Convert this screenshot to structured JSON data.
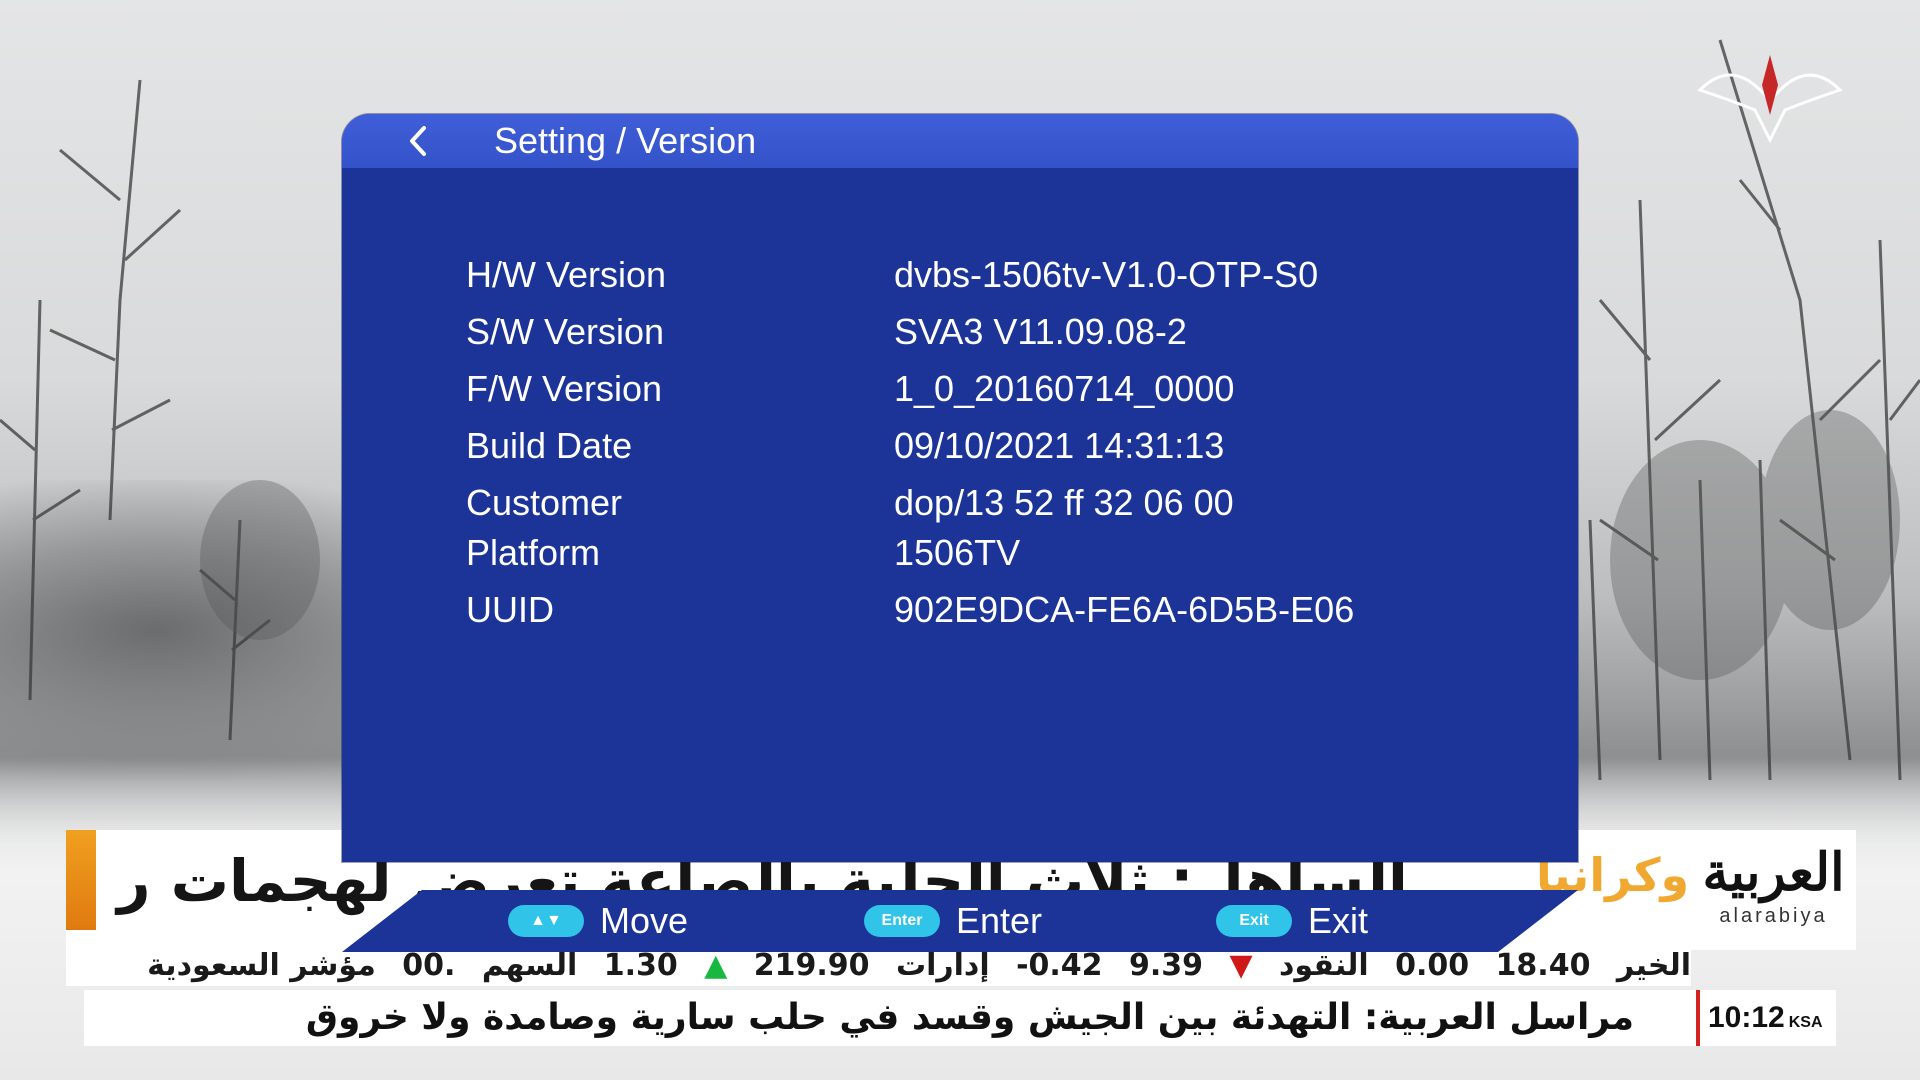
{
  "osd": {
    "title": "Setting / Version",
    "rows": [
      {
        "label": "H/W Version",
        "value": "dvbs-1506tv-V1.0-OTP-S0"
      },
      {
        "label": "S/W Version",
        "value": "SVA3 V11.09.08-2"
      },
      {
        "label": "F/W Version",
        "value": "1_0_20160714_0000"
      },
      {
        "label": "Build Date",
        "value": "09/10/2021 14:31:13"
      },
      {
        "label": "Customer",
        "value": "dop/13 52 ff 32 06 00"
      },
      {
        "label": "Platform",
        "value": "1506TV"
      },
      {
        "label": "UUID",
        "value": "902E9DCA-FE6A-6D5B-E06"
      }
    ],
    "footer": {
      "move": {
        "key": "▲▼",
        "label": "Move"
      },
      "enter": {
        "key": "Enter",
        "label": "Enter"
      },
      "exit": {
        "key": "Exit",
        "label": "Exit"
      }
    }
  },
  "broadcast": {
    "headline": "...الساهل: ثلاث الحلية بالصاعة تعرض لهجمات روسية",
    "tag": "أوكرانيا",
    "logo_ar": "العربية",
    "logo_en": "alarabiya",
    "ticker": [
      "الخير",
      "18.40",
      "0.00",
      "النقود",
      "9.39",
      "-0.42",
      "إدارات",
      "219.90",
      "1.30",
      "السهم",
      "00.",
      "مؤشر السعودية"
    ],
    "breaking": "مراسل العربية: التهدئة بين الجيش وقسد في حلب سارية وصامدة ولا خروق",
    "clock_time": "10:12",
    "clock_tz": "KSA"
  },
  "colors": {
    "osd_body": "#1c3497",
    "osd_header": "#3453c9",
    "key_pill": "#2fc4e8",
    "accent": "#f0a020"
  }
}
